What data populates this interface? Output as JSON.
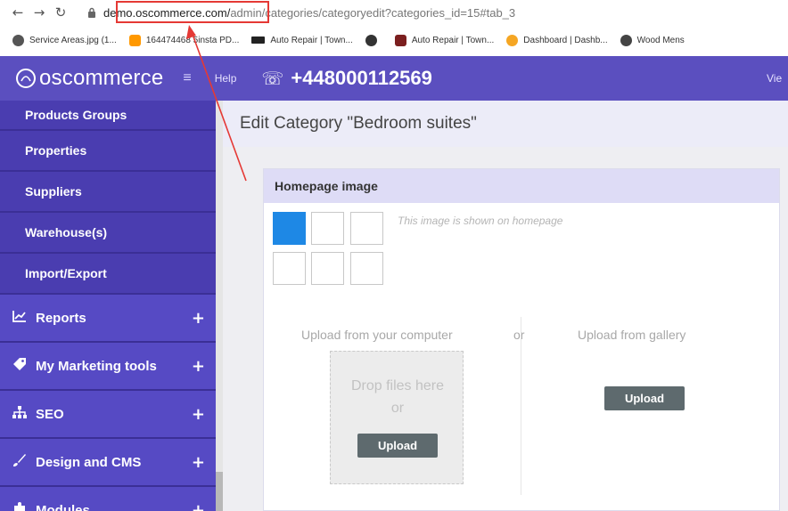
{
  "browser": {
    "url_domain": "demo.oscommerce.com/",
    "url_path": "admin/categories/categoryedit?categories_id=15#tab_3",
    "bookmarks": [
      {
        "label": "Service Areas.jpg (1...",
        "icon_color": "#555555"
      },
      {
        "label": "164474468 5insta PD...",
        "icon_color": "#ff9800"
      },
      {
        "label": "Auto Repair | Town...",
        "icon_color": "#222222"
      },
      {
        "label": "",
        "icon_color": "#333333"
      },
      {
        "label": "Auto Repair | Town...",
        "icon_color": "#7b1f1f"
      },
      {
        "label": "Dashboard | Dashb...",
        "icon_color": "#f5a623"
      },
      {
        "label": "Wood Mens",
        "icon_color": "#444444"
      }
    ]
  },
  "header": {
    "logo": "oscommerce",
    "help": "Help",
    "phone": "+448000112569",
    "view": "Vie"
  },
  "sidebar": {
    "sub_items": [
      {
        "label": "Products Groups"
      },
      {
        "label": "Properties"
      },
      {
        "label": "Suppliers"
      },
      {
        "label": "Warehouse(s)"
      },
      {
        "label": "Import/Export"
      }
    ],
    "main_items": [
      {
        "label": "Reports",
        "icon": "chart-icon"
      },
      {
        "label": "My Marketing tools",
        "icon": "tag-icon"
      },
      {
        "label": "SEO",
        "icon": "sitemap-icon"
      },
      {
        "label": "Design and CMS",
        "icon": "brush-icon"
      },
      {
        "label": "Modules",
        "icon": "puzzle-icon"
      }
    ]
  },
  "page": {
    "title": "Edit Category \"Bedroom suites\""
  },
  "homepage_image": {
    "title": "Homepage image",
    "hint": "This image is shown on homepage",
    "upload_computer_title": "Upload from your computer",
    "or": "or",
    "upload_gallery_title": "Upload from gallery",
    "drop_text_1": "Drop files here",
    "drop_text_2": "or",
    "upload_label": "Upload",
    "gallery_upload_label": "Upload"
  },
  "colors": {
    "brand": "#5b4fbf",
    "sidebar": "#4a3db0",
    "active_thumb": "#1e88e5",
    "annotation": "#e53935"
  }
}
